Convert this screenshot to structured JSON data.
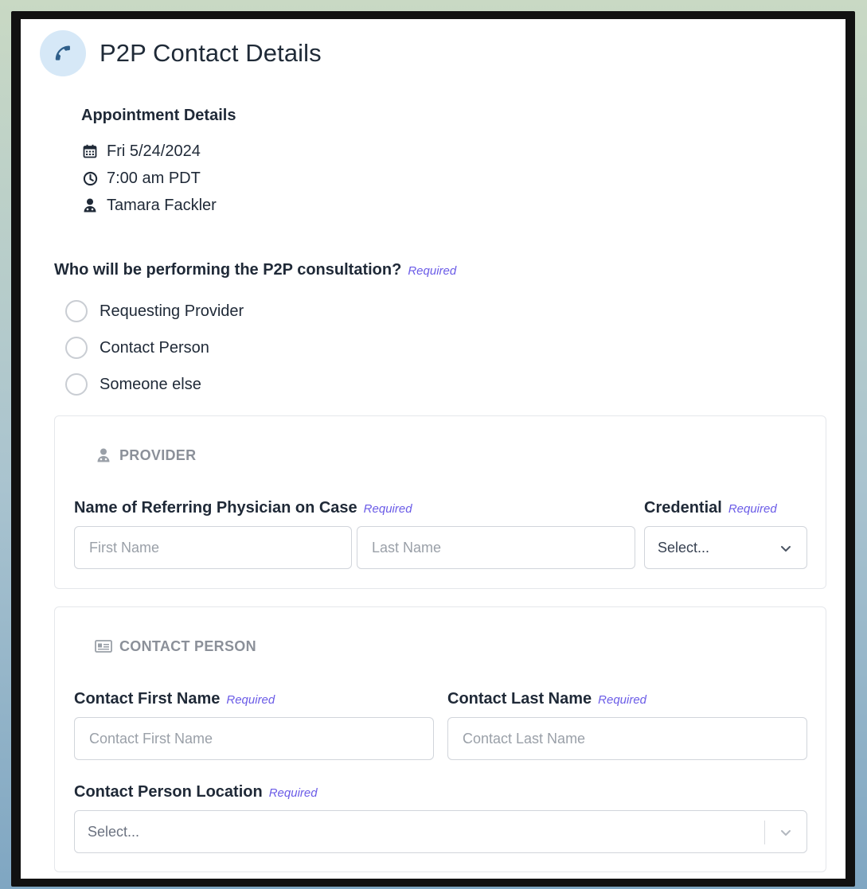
{
  "header": {
    "title": "P2P Contact Details",
    "icon": "phone-icon"
  },
  "appointment": {
    "title": "Appointment Details",
    "date": "Fri 5/24/2024",
    "time": "7:00 am PDT",
    "person": "Tamara Fackler"
  },
  "question": {
    "label": "Who will be performing the P2P consultation?",
    "required": "Required",
    "options": [
      "Requesting Provider",
      "Contact Person",
      "Someone else"
    ]
  },
  "provider": {
    "section_title": "PROVIDER",
    "name_label": "Name of Referring Physician on Case",
    "name_required": "Required",
    "first_placeholder": "First Name",
    "last_placeholder": "Last Name",
    "credential_label": "Credential",
    "credential_required": "Required",
    "credential_value": "Select..."
  },
  "contact": {
    "section_title": "CONTACT PERSON",
    "first_label": "Contact First Name",
    "first_required": "Required",
    "first_placeholder": "Contact First Name",
    "last_label": "Contact Last Name",
    "last_required": "Required",
    "last_placeholder": "Contact Last Name",
    "location_label": "Contact Person Location",
    "location_required": "Required",
    "location_value": "Select..."
  },
  "colors": {
    "accent_required": "#6b5ce7",
    "icon_bg": "#d6e8f7",
    "icon_fg": "#2f5f8a"
  }
}
